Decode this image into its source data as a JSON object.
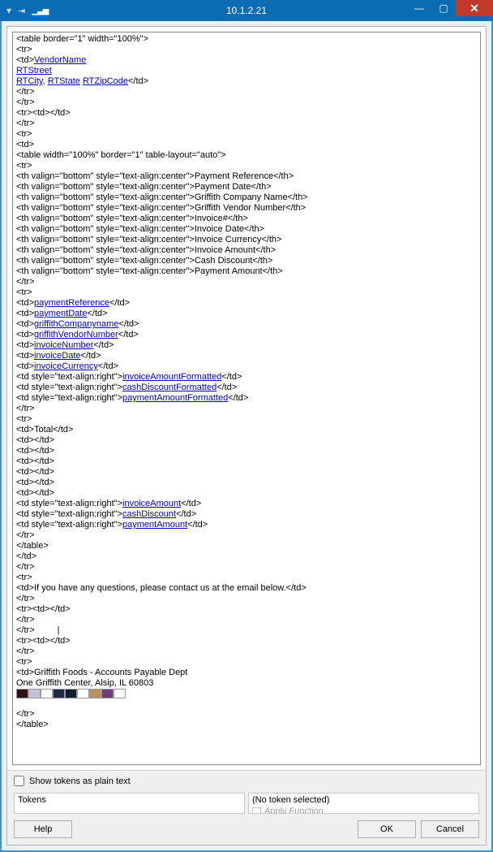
{
  "titlebar": {
    "address": "10.1.2.21"
  },
  "dialog": {
    "show_plain_label": "Show tokens as plain text",
    "tokens_label": "Tokens",
    "no_token_label": "(No token selected)",
    "apply_label": "Apply Function",
    "help": "Help",
    "ok": "OK",
    "cancel": "Cancel"
  },
  "code": {
    "l01": "<table border=\"1\" width=\"100%\">",
    "l02": "<tr>",
    "l03a": "<td>",
    "tok_VendorName": "VendorName",
    "tok_RTStreet": "RTStreet",
    "tok_RTCity": "RTCity",
    "l05_sep": ", ",
    "tok_RTState": "RTState",
    "l05_sp": " ",
    "tok_RTZipCode": "RTZipCode",
    "l05_end": "</td>",
    "l06": "</tr>",
    "l07": "</tr>",
    "l08": "<tr><td></td>",
    "l09": "</tr>",
    "l10": "<tr>",
    "l11": "<td>",
    "l12": "<table width=\"100%\" border=\"1\" table-layout=\"auto\">",
    "l13": "<tr>",
    "l14": "<th valign=\"bottom\" style=\"text-align:center\">Payment Reference</th>",
    "l15": "<th valign=\"bottom\" style=\"text-align:center\">Payment Date</th>",
    "l16": "<th valign=\"bottom\" style=\"text-align:center\">Griffith Company Name</th>",
    "l17": "<th valign=\"bottom\" style=\"text-align:center\">Griffith Vendor Number</th>",
    "l18": "<th valign=\"bottom\" style=\"text-align:center\">Invoice#</th>",
    "l19": "<th valign=\"bottom\" style=\"text-align:center\">Invoice Date</th>",
    "l20": "<th valign=\"bottom\" style=\"text-align:center\">Invoice Currency</th>",
    "l21": "<th valign=\"bottom\" style=\"text-align:center\">Invoice Amount</th>",
    "l22": "<th valign=\"bottom\" style=\"text-align:center\">Cash Discount</th>",
    "l23": "<th valign=\"bottom\" style=\"text-align:center\">Payment Amount</th>",
    "l24": "</tr>",
    "l25": "<tr>",
    "td_open": "<td>",
    "td_close": "</td>",
    "tok_paymentReference": "paymentReference",
    "tok_paymentDate": "paymentDate",
    "tok_griffithCompanyname": "griffithCompanyname",
    "tok_griffithVendorNumber": "griffithVendorNumber",
    "tok_invoiceNumber": "invoiceNumber",
    "tok_invoiceDate": "invoiceDate",
    "tok_invoiceCurrency": "invoiceCurrency",
    "td_right_open": "<td style=\"text-align:right\">",
    "tok_invoiceAmountFormatted": "invoiceAmountFormatted",
    "tok_cashDiscountFormatted": "cashDiscountFormatted",
    "tok_paymentAmountFormatted": "paymentAmountFormatted",
    "l37": "</tr>",
    "l38": "<tr>",
    "l39": "<td>Total</td>",
    "l40": "<td></td>",
    "tok_invoiceAmount": "invoiceAmount",
    "tok_cashDiscount": "cashDiscount",
    "tok_paymentAmount": "paymentAmount",
    "l49": "</tr>",
    "l50": "</table>",
    "l51": "</td>",
    "l52": "</tr>",
    "l53": "<tr>",
    "l54": "<td>If you have any questions, please contact us at the email below.</td>",
    "l55": "</tr>",
    "l56": "<tr><td></td>",
    "l57": "</tr>",
    "l58": "</tr>",
    "caret": "|",
    "l59": "<tr><td></td>",
    "l60": "</tr>",
    "l61": "<tr>",
    "l62": "<td>Griffith Foods - Accounts Payable Dept",
    "l63": "One Griffith Center, Alsip, IL 60803",
    "l65": "</tr>",
    "l66": "</table>"
  },
  "swatches": [
    "#2b1014",
    "#c7c0d8",
    "#ffffff",
    "#1f2a44",
    "#0f1d33",
    "#ffffff",
    "#b98f5a",
    "#6b3e78",
    "#ffffff"
  ]
}
